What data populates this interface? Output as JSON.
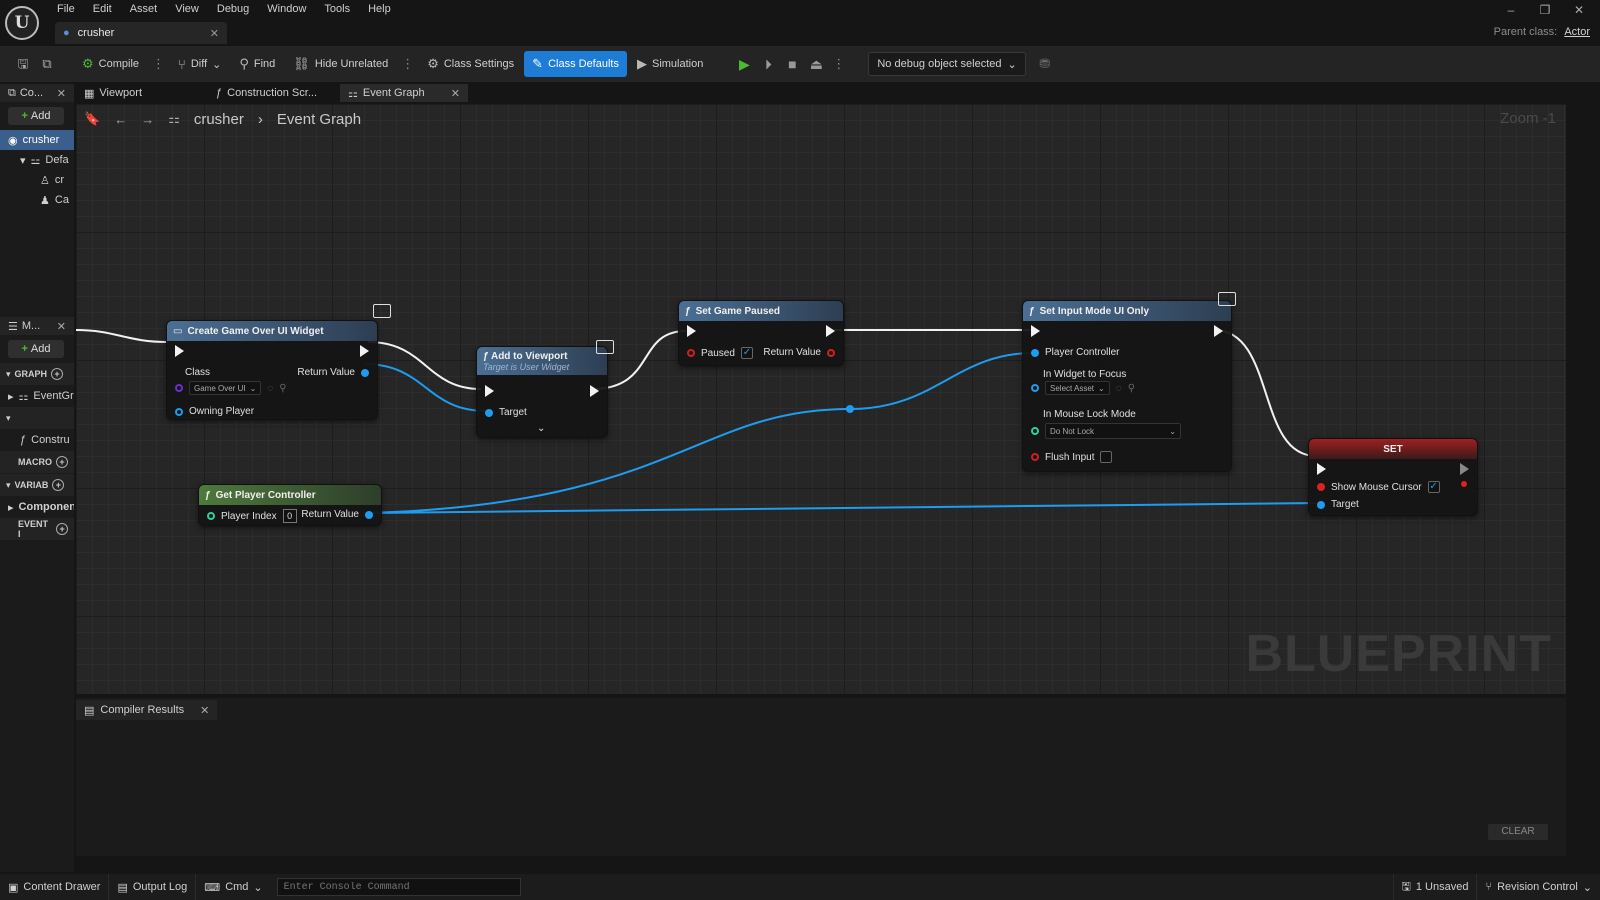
{
  "window": {
    "logo": "U",
    "menu": [
      "File",
      "Edit",
      "Asset",
      "View",
      "Debug",
      "Window",
      "Tools",
      "Help"
    ],
    "doc_tab": "crusher",
    "controls": [
      "–",
      "❐",
      "✕"
    ],
    "parent_class_label": "Parent class:",
    "parent_class_value": "Actor"
  },
  "toolbar": {
    "compile": "Compile",
    "diff": "Diff",
    "find": "Find",
    "hide_unrelated": "Hide Unrelated",
    "class_settings": "Class Settings",
    "class_defaults": "Class Defaults",
    "simulation": "Simulation",
    "debug_object": "No debug object selected",
    "accent": "#1c7cd6"
  },
  "left_panel": {
    "components_tab": "Co...",
    "add": "Add",
    "tree": [
      "crusher",
      "Defa",
      "cr",
      "Ca"
    ],
    "my_blueprint_tab": "M...",
    "add2": "Add",
    "graphs": "GRAPH",
    "event_graph": "EventGr",
    "construct": "Constru",
    "macros": "MACRO",
    "variables": "VARIAB",
    "components": "Components",
    "event_dispatchers": "EVENT I"
  },
  "editor_tabs": [
    {
      "label": "Viewport",
      "icon": "viewport-icon"
    },
    {
      "label": "Construction Scr...",
      "icon": "function-icon"
    },
    {
      "label": "Event Graph",
      "icon": "graph-icon"
    }
  ],
  "graph": {
    "breadcrumb": [
      "crusher",
      "Event Graph"
    ],
    "zoom": "Zoom -1",
    "watermark": "BLUEPRINT",
    "nodes": {
      "create_widget": {
        "title": "Create Game Over UI Widget",
        "class_label": "Class",
        "class_value": "Game Over UI",
        "return_value": "Return Value",
        "owning_player": "Owning Player"
      },
      "add_to_viewport": {
        "title": "Add to Viewport",
        "subtitle": "Target is User Widget",
        "target": "Target"
      },
      "set_game_paused": {
        "title": "Set Game Paused",
        "paused": "Paused",
        "return_value": "Return Value"
      },
      "set_input_mode": {
        "title": "Set Input Mode UI Only",
        "player_controller": "Player Controller",
        "widget_focus": "In Widget to Focus",
        "select_asset": "Select Asset",
        "mouse_lock": "In Mouse Lock Mode",
        "mouse_lock_value": "Do Not Lock",
        "flush_input": "Flush Input"
      },
      "get_player_controller": {
        "title": "Get Player Controller",
        "player_index": "Player Index",
        "player_index_value": "0",
        "return_value": "Return Value"
      },
      "set": {
        "title": "SET",
        "show_mouse_cursor": "Show Mouse Cursor",
        "target": "Target"
      }
    }
  },
  "compiler": {
    "tab": "Compiler Results",
    "clear": "CLEAR"
  },
  "statusbar": {
    "content_drawer": "Content Drawer",
    "output_log": "Output Log",
    "cmd": "Cmd",
    "console_placeholder": "Enter Console Command",
    "unsaved": "1 Unsaved",
    "revision_control": "Revision Control"
  }
}
